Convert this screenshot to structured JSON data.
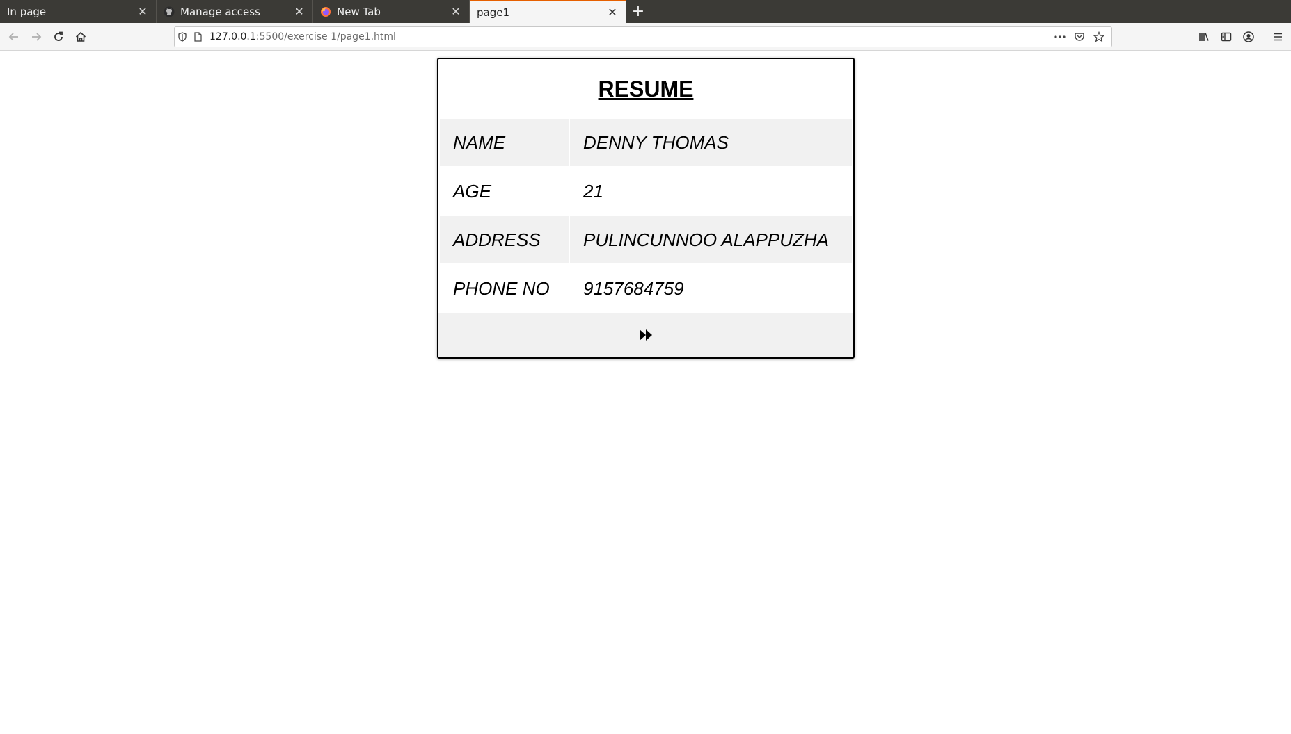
{
  "browser": {
    "tabs": [
      {
        "title": "In page",
        "active": false,
        "favicon": "none"
      },
      {
        "title": "Manage access",
        "active": false,
        "favicon": "github-icon"
      },
      {
        "title": "New Tab",
        "active": false,
        "favicon": "firefox-icon"
      },
      {
        "title": "page1",
        "active": true,
        "favicon": "none"
      }
    ],
    "url_host": "127.0.0.1",
    "url_path": ":5500/exercise 1/page1.html",
    "accent_color": "#e66000"
  },
  "page": {
    "title": "RESUME",
    "rows": [
      {
        "label": "NAME",
        "value": "DENNY THOMAS"
      },
      {
        "label": "AGE",
        "value": "21"
      },
      {
        "label": "ADDRESS",
        "value": "PULINCUNNOO ALAPPUZHA"
      },
      {
        "label": "PHONE NO",
        "value": "9157684759"
      }
    ],
    "next_icon": "fast-forward-icon"
  }
}
